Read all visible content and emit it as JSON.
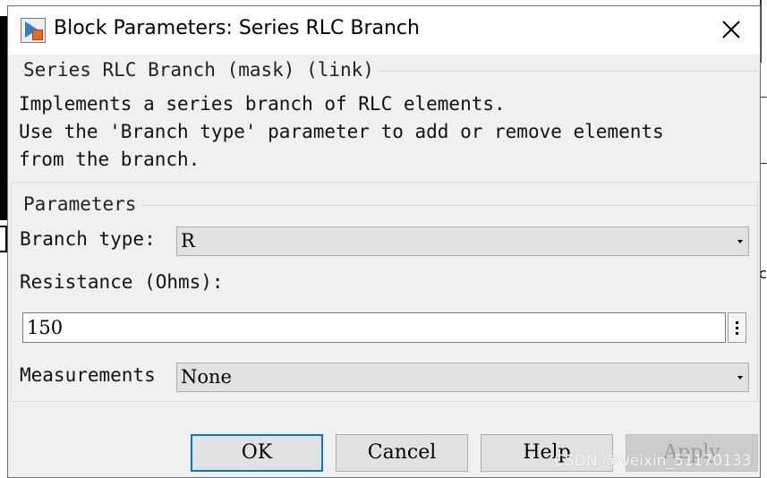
{
  "window": {
    "title": "Block Parameters: Series RLC Branch",
    "icon": "simulink-block-icon"
  },
  "mask": {
    "title": "Series RLC Branch (mask) (link)",
    "description_lines": [
      "Implements a series branch of RLC elements.",
      "Use the 'Branch type' parameter to add or remove elements",
      "from the branch."
    ]
  },
  "parameters": {
    "title": "Parameters",
    "branch_type": {
      "label": "Branch type:",
      "value": "R"
    },
    "resistance": {
      "label": "Resistance (Ohms):",
      "value": "150"
    },
    "measurements": {
      "label": "Measurements",
      "value": "None"
    }
  },
  "buttons": {
    "ok": "OK",
    "cancel": "Cancel",
    "help": "Help",
    "apply": "Apply"
  },
  "watermark": "CSDN @weixin_51170133",
  "colors": {
    "focus_border": "#0078d7",
    "dialog_bg": "#f0f0f0"
  }
}
